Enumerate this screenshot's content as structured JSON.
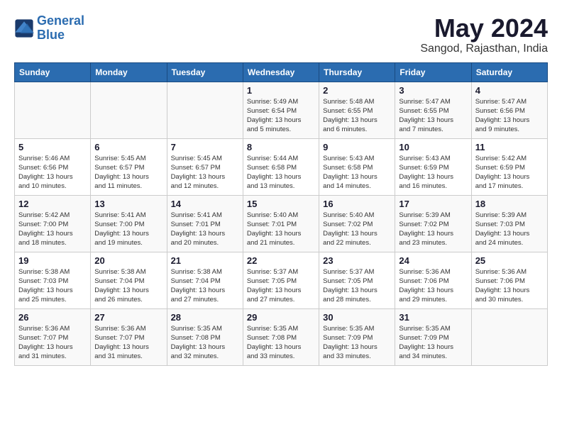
{
  "logo": {
    "line1": "General",
    "line2": "Blue"
  },
  "title": "May 2024",
  "location": "Sangod, Rajasthan, India",
  "days_of_week": [
    "Sunday",
    "Monday",
    "Tuesday",
    "Wednesday",
    "Thursday",
    "Friday",
    "Saturday"
  ],
  "weeks": [
    [
      {
        "day": "",
        "info": ""
      },
      {
        "day": "",
        "info": ""
      },
      {
        "day": "",
        "info": ""
      },
      {
        "day": "1",
        "info": "Sunrise: 5:49 AM\nSunset: 6:54 PM\nDaylight: 13 hours\nand 5 minutes."
      },
      {
        "day": "2",
        "info": "Sunrise: 5:48 AM\nSunset: 6:55 PM\nDaylight: 13 hours\nand 6 minutes."
      },
      {
        "day": "3",
        "info": "Sunrise: 5:47 AM\nSunset: 6:55 PM\nDaylight: 13 hours\nand 7 minutes."
      },
      {
        "day": "4",
        "info": "Sunrise: 5:47 AM\nSunset: 6:56 PM\nDaylight: 13 hours\nand 9 minutes."
      }
    ],
    [
      {
        "day": "5",
        "info": "Sunrise: 5:46 AM\nSunset: 6:56 PM\nDaylight: 13 hours\nand 10 minutes."
      },
      {
        "day": "6",
        "info": "Sunrise: 5:45 AM\nSunset: 6:57 PM\nDaylight: 13 hours\nand 11 minutes."
      },
      {
        "day": "7",
        "info": "Sunrise: 5:45 AM\nSunset: 6:57 PM\nDaylight: 13 hours\nand 12 minutes."
      },
      {
        "day": "8",
        "info": "Sunrise: 5:44 AM\nSunset: 6:58 PM\nDaylight: 13 hours\nand 13 minutes."
      },
      {
        "day": "9",
        "info": "Sunrise: 5:43 AM\nSunset: 6:58 PM\nDaylight: 13 hours\nand 14 minutes."
      },
      {
        "day": "10",
        "info": "Sunrise: 5:43 AM\nSunset: 6:59 PM\nDaylight: 13 hours\nand 16 minutes."
      },
      {
        "day": "11",
        "info": "Sunrise: 5:42 AM\nSunset: 6:59 PM\nDaylight: 13 hours\nand 17 minutes."
      }
    ],
    [
      {
        "day": "12",
        "info": "Sunrise: 5:42 AM\nSunset: 7:00 PM\nDaylight: 13 hours\nand 18 minutes."
      },
      {
        "day": "13",
        "info": "Sunrise: 5:41 AM\nSunset: 7:00 PM\nDaylight: 13 hours\nand 19 minutes."
      },
      {
        "day": "14",
        "info": "Sunrise: 5:41 AM\nSunset: 7:01 PM\nDaylight: 13 hours\nand 20 minutes."
      },
      {
        "day": "15",
        "info": "Sunrise: 5:40 AM\nSunset: 7:01 PM\nDaylight: 13 hours\nand 21 minutes."
      },
      {
        "day": "16",
        "info": "Sunrise: 5:40 AM\nSunset: 7:02 PM\nDaylight: 13 hours\nand 22 minutes."
      },
      {
        "day": "17",
        "info": "Sunrise: 5:39 AM\nSunset: 7:02 PM\nDaylight: 13 hours\nand 23 minutes."
      },
      {
        "day": "18",
        "info": "Sunrise: 5:39 AM\nSunset: 7:03 PM\nDaylight: 13 hours\nand 24 minutes."
      }
    ],
    [
      {
        "day": "19",
        "info": "Sunrise: 5:38 AM\nSunset: 7:03 PM\nDaylight: 13 hours\nand 25 minutes."
      },
      {
        "day": "20",
        "info": "Sunrise: 5:38 AM\nSunset: 7:04 PM\nDaylight: 13 hours\nand 26 minutes."
      },
      {
        "day": "21",
        "info": "Sunrise: 5:38 AM\nSunset: 7:04 PM\nDaylight: 13 hours\nand 27 minutes."
      },
      {
        "day": "22",
        "info": "Sunrise: 5:37 AM\nSunset: 7:05 PM\nDaylight: 13 hours\nand 27 minutes."
      },
      {
        "day": "23",
        "info": "Sunrise: 5:37 AM\nSunset: 7:05 PM\nDaylight: 13 hours\nand 28 minutes."
      },
      {
        "day": "24",
        "info": "Sunrise: 5:36 AM\nSunset: 7:06 PM\nDaylight: 13 hours\nand 29 minutes."
      },
      {
        "day": "25",
        "info": "Sunrise: 5:36 AM\nSunset: 7:06 PM\nDaylight: 13 hours\nand 30 minutes."
      }
    ],
    [
      {
        "day": "26",
        "info": "Sunrise: 5:36 AM\nSunset: 7:07 PM\nDaylight: 13 hours\nand 31 minutes."
      },
      {
        "day": "27",
        "info": "Sunrise: 5:36 AM\nSunset: 7:07 PM\nDaylight: 13 hours\nand 31 minutes."
      },
      {
        "day": "28",
        "info": "Sunrise: 5:35 AM\nSunset: 7:08 PM\nDaylight: 13 hours\nand 32 minutes."
      },
      {
        "day": "29",
        "info": "Sunrise: 5:35 AM\nSunset: 7:08 PM\nDaylight: 13 hours\nand 33 minutes."
      },
      {
        "day": "30",
        "info": "Sunrise: 5:35 AM\nSunset: 7:09 PM\nDaylight: 13 hours\nand 33 minutes."
      },
      {
        "day": "31",
        "info": "Sunrise: 5:35 AM\nSunset: 7:09 PM\nDaylight: 13 hours\nand 34 minutes."
      },
      {
        "day": "",
        "info": ""
      }
    ]
  ]
}
